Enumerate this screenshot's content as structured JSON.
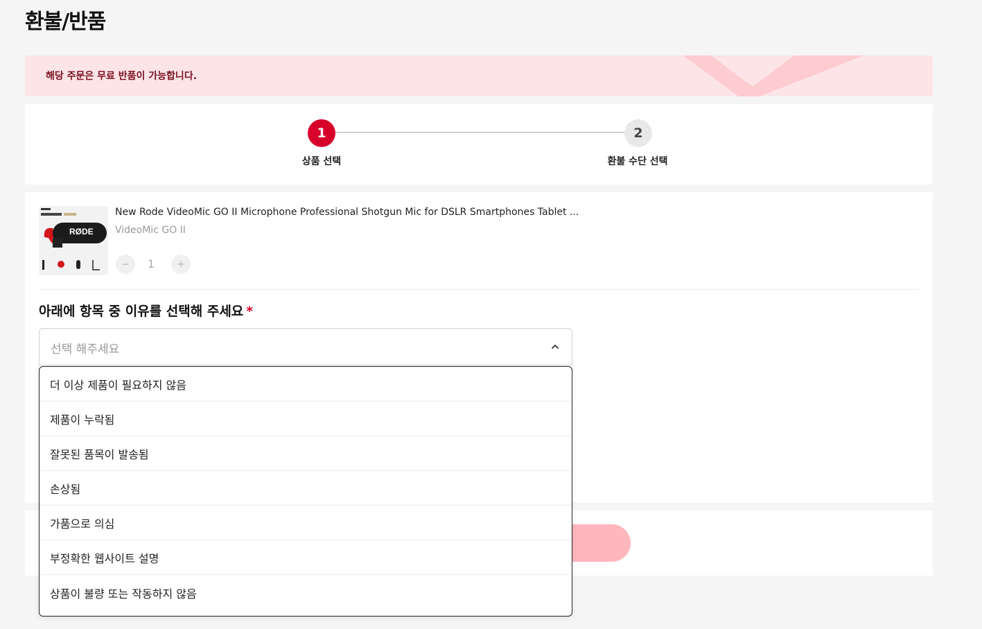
{
  "page": {
    "title": "환불/반품"
  },
  "banner": {
    "text": "해당 주문은 무료 반품이 가능합니다."
  },
  "stepper": {
    "steps": [
      {
        "number": "1",
        "label": "상품 선택"
      },
      {
        "number": "2",
        "label": "환불 수단 선택"
      }
    ]
  },
  "product": {
    "name": "New Rode VideoMic GO II Microphone Professional Shotgun Mic for DSLR Smartphones Tablet ...",
    "variant": "VideoMic GO II",
    "quantity": "1",
    "minus": "−",
    "plus": "+",
    "thumb_brand": "RØDE"
  },
  "reason": {
    "label": "아래에 항목 중 이유를 선택해 주세요",
    "required": "*",
    "placeholder": "선택 해주세요",
    "options": [
      "더 이상 제품이 필요하지 않음",
      "제품이 누락됨",
      "잘못된 품목이 발송됨",
      "손상됨",
      "가품으로 의심",
      "부정확한 웹사이트 설명",
      "상품이 불량 또는 작동하지 않음"
    ]
  },
  "colors": {
    "accent": "#d6002a",
    "banner_bg": "#fde4e6",
    "submit_disabled": "#ffb6bd"
  }
}
